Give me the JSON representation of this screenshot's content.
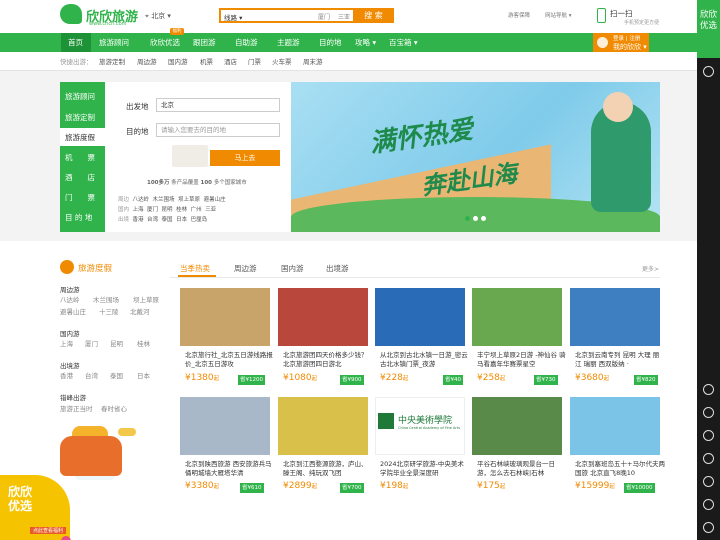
{
  "brand": {
    "name": "欣欣旅游",
    "url": "www.cncn.com"
  },
  "header": {
    "city": "北京 ▾",
    "search_category": "线路 ▾",
    "hint1": "厦门",
    "hint2": "三亚",
    "search_button": "搜 索",
    "link1": "游客保障",
    "link2": "网站导航 ▾",
    "app_title": "扫一扫",
    "app_sub": "手机预定更方便"
  },
  "nav": {
    "items": [
      "首页",
      "旅游顾问",
      "欣欣优选",
      "跟团游",
      "自助游",
      "主题游",
      "目的地",
      "攻略 ▾",
      "百宝箱 ▾"
    ],
    "badge": "福利",
    "login_line1": "登录 | 注册",
    "login_line2": "我的欣欣 ▾"
  },
  "quick": {
    "label": "快捷出游：",
    "items": [
      "旅游定制",
      "周边游",
      "国内游",
      "机票",
      "酒店",
      "门票",
      "火车票",
      "周末游"
    ]
  },
  "side": {
    "brand": "欣欣优选"
  },
  "left_menu": [
    "旅游顾问",
    "旅游定制",
    "旅游度假",
    "机　　票",
    "酒　　店",
    "门　　票",
    "目 的 地"
  ],
  "search_panel": {
    "from_label": "出发地",
    "from_value": "北京",
    "to_label": "目的地",
    "to_placeholder": "请输入您要去的目的地",
    "go_button": "马上去",
    "stats_num1": "100多万",
    "stats_text1": "条产品覆盖",
    "stats_num2": "100",
    "stats_text2": "多个国家城市",
    "rows": [
      {
        "label": "周边",
        "items": [
          "八达岭",
          "木兰围场",
          "坝上草原",
          "避暑山庄"
        ]
      },
      {
        "label": "国内",
        "items": [
          "上海",
          "厦门",
          "昆明",
          "桂林",
          "广州",
          "三亚"
        ]
      },
      {
        "label": "出境",
        "items": [
          "香港",
          "台湾",
          "泰国",
          "日本",
          "巴厘岛"
        ]
      }
    ]
  },
  "banner": {
    "line1": "满怀热爱",
    "line2": "奔赴山海"
  },
  "section": {
    "title": "旅游度假",
    "tabs": [
      "当季热卖",
      "周边游",
      "国内游",
      "出境游"
    ],
    "more": "更多>",
    "categories": [
      {
        "title": "周边游",
        "items": [
          "八达岭",
          "木兰围场",
          "坝上草原",
          "避暑山庄",
          "十三陵",
          "北戴河"
        ]
      },
      {
        "title": "国内游",
        "items": [
          "上海",
          "厦门",
          "昆明",
          "桂林"
        ]
      },
      {
        "title": "出境游",
        "items": [
          "香港",
          "台湾",
          "泰国",
          "日本"
        ]
      },
      {
        "title": "错峰出游",
        "items": [
          "旅游正当时",
          "春时省心"
        ]
      }
    ]
  },
  "cards": [
    {
      "title": "北京旅行社_北京五日游线路报价_北京五日游攻",
      "price": "¥1380",
      "unit": "起",
      "save": "省¥1200",
      "color": "#c8a36a"
    },
    {
      "title": "北京旅游团四天价格多少钱？北京旅游团四日游北",
      "price": "¥1080",
      "unit": "起",
      "save": "省¥900",
      "color": "#b9473b"
    },
    {
      "title": "从北京到古北水镇一日游_密云古北水镇门票_夜游",
      "price": "¥228",
      "unit": "起",
      "save": "省¥40",
      "color": "#2a6bb8"
    },
    {
      "title": "丰宁坝上草原2日游 -神仙谷 骑马看嘉年华赛票星空",
      "price": "¥258",
      "unit": "起",
      "save": "省¥730",
      "color": "#6aa84f"
    },
    {
      "title": "北京到云南专列 昆明 大理 丽江 瑞丽 西双版纳 ·",
      "price": "¥3680",
      "unit": "起",
      "save": "省¥820",
      "color": "#3d7fc1"
    },
    {
      "title": "北京到陕西旅游 西安旅游兵马俑明城墙大雁塔华清",
      "price": "¥3380",
      "unit": "起",
      "save": "省¥610",
      "color": "#a8b8c8"
    },
    {
      "title": "北京到江西婺源旅游，庐山、滕王阁、纯玩双飞团",
      "price": "¥2899",
      "unit": "起",
      "save": "省¥700",
      "color": "#d8c04a"
    },
    {
      "title": "2024北京研学旅游-中央美术学院毕业全景深度研",
      "price": "¥198",
      "unit": "起",
      "save": "",
      "color": "#ffffff"
    },
    {
      "title": "平谷石林峡玻璃观景台一日游，怎么去石林峡|石林",
      "price": "¥175",
      "unit": "起",
      "save": "",
      "color": "#5a8a4a"
    },
    {
      "title": "北京到塞班岛五十+马尔代夫两国旅 北京直飞8晚10",
      "price": "¥15999",
      "unit": "起",
      "save": "省¥10000",
      "color": "#7cc3e8"
    }
  ],
  "card9_logo": "中央美術學院",
  "card9_logo_sub": "China Central Academy of Fine Arts",
  "promo": {
    "title_l1": "欣欣",
    "title_l2": "优选",
    "tag": "点此查看福利"
  }
}
